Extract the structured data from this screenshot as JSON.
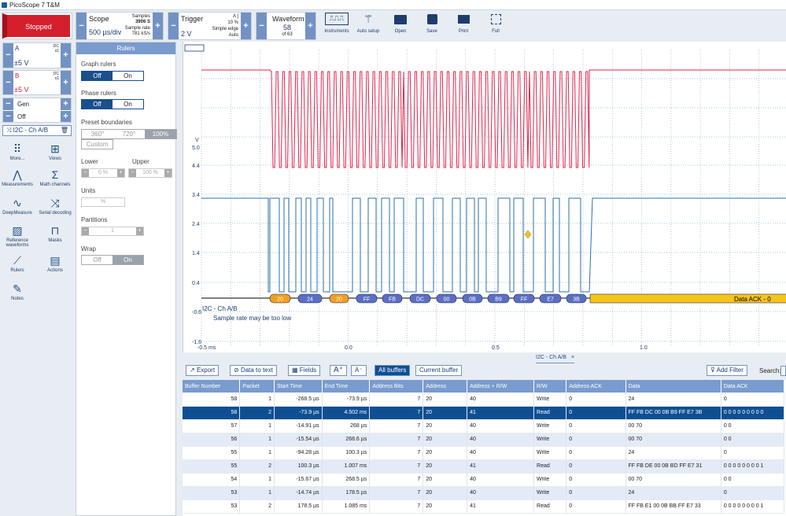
{
  "app": {
    "title": "PicoScope 7 T&M",
    "status": "Stopped"
  },
  "scope": {
    "label": "Scope",
    "timebase": "500 µs/div",
    "samples_label": "Samples",
    "samples": "3906 S",
    "rate_label": "Sample rate",
    "rate": "781 kS/s"
  },
  "trigger": {
    "label": "Trigger",
    "level": "2 V",
    "channel": "A",
    "percent": "10 %",
    "type": "Simple edge",
    "mode": "Auto"
  },
  "waveform": {
    "label": "Waveform",
    "current": "58",
    "of": "of 63"
  },
  "toolbar": {
    "instruments": "Instruments",
    "auto_setup": "Auto setup",
    "open": "Open",
    "save": "Save",
    "print": "Print",
    "full": "Full"
  },
  "channels": {
    "a": {
      "name": "A",
      "coupling": "DC",
      "probe": "x1",
      "range": "±5 V"
    },
    "b": {
      "name": "B",
      "coupling": "DC",
      "probe": "x1",
      "range": "±5 V"
    },
    "gen": {
      "name": "Gen",
      "state": "Off"
    }
  },
  "decoder": {
    "label": "I2C - Ch A/B"
  },
  "sidebar": {
    "more": "More...",
    "views": "Views",
    "measurements": "Measurements",
    "math": "Math channels",
    "deepmeasure": "DeepMeasure",
    "serial": "Serial decoding",
    "reference": "Reference waveforms",
    "masks": "Masks",
    "rulers": "Rulers",
    "actions": "Actions",
    "notes": "Notes"
  },
  "rulers": {
    "title": "Rulers",
    "graph": "Graph rulers",
    "phase": "Phase rulers",
    "off": "Off",
    "on": "On",
    "preset": "Preset boundaries",
    "p360": "360°",
    "p720": "720°",
    "p100": "100%",
    "custom": "Custom",
    "lower": "Lower",
    "upper": "Upper",
    "lower_val": "0 %",
    "upper_val": "100 %",
    "units": "Units",
    "units_val": "%",
    "partitions": "Partitions",
    "partitions_val": "1",
    "wrap": "Wrap"
  },
  "plot": {
    "v_unit": "V",
    "yticks": [
      "5.0",
      "4.4",
      "3.4",
      "2.4",
      "1.4",
      "0.4",
      "-0.6",
      "-1.6"
    ],
    "xticks": [
      "-0.5 ms",
      "0.0",
      "0.5",
      "1.0"
    ],
    "warn_ch": "I2C - Ch A/B",
    "warn": "Sample rate may be too low",
    "ack": "Data ACK - 0",
    "packets": [
      "20",
      "24",
      "20",
      "FF",
      "FB",
      "DC",
      "00",
      "0B",
      "B9",
      "FF",
      "E7",
      "3B"
    ]
  },
  "bottom": {
    "tab": "I2C - Ch A/B",
    "export": "Export",
    "data_to_text": "Data to text",
    "fields": "Fields",
    "all_buffers": "All buffers",
    "current_buffer": "Current buffer",
    "add_filter": "Add Filter",
    "search": "Search:"
  },
  "table": {
    "headers": [
      "Buffer Number",
      "Packet",
      "Start Time",
      "End Time",
      "Address Bits",
      "Address",
      "Address + R/W",
      "R/W",
      "Address ACK",
      "Data",
      "Data ACK"
    ],
    "rows": [
      [
        "58",
        "1",
        "-268.5 µs",
        "-73.9 µs",
        "7",
        "20",
        "40",
        "Write",
        "0",
        "24",
        "0"
      ],
      [
        "58",
        "2",
        "-73.9 µs",
        "4.502 ms",
        "7",
        "20",
        "41",
        "Read",
        "0",
        "FF FB DC 00 0B B9 FF E7 3B",
        "0 0 0 0 0 0 0 0 0"
      ],
      [
        "57",
        "1",
        "-14.91 µs",
        "268 µs",
        "7",
        "20",
        "40",
        "Write",
        "0",
        "00 70",
        "0 0"
      ],
      [
        "56",
        "1",
        "-15.54 µs",
        "268.6 µs",
        "7",
        "20",
        "40",
        "Write",
        "0",
        "00 70",
        "0 0"
      ],
      [
        "55",
        "1",
        "-94.28 µs",
        "100.3 µs",
        "7",
        "20",
        "40",
        "Write",
        "0",
        "24",
        "0"
      ],
      [
        "55",
        "2",
        "100.3 µs",
        "1.007 ms",
        "7",
        "20",
        "41",
        "Read",
        "0",
        "FF FB DE 00 0B BD FF E7 31",
        "0 0 0 0 0 0 0 0 1"
      ],
      [
        "54",
        "1",
        "-15.67 µs",
        "268.5 µs",
        "7",
        "20",
        "40",
        "Write",
        "0",
        "00 70",
        "0 0"
      ],
      [
        "53",
        "1",
        "-14.74 µs",
        "178.5 µs",
        "7",
        "20",
        "40",
        "Write",
        "0",
        "24",
        "0"
      ],
      [
        "53",
        "2",
        "178.5 µs",
        "1.085 ms",
        "7",
        "20",
        "41",
        "Read",
        "0",
        "FF FB E1 00 0B BB FF E7 33",
        "0 0 0 0 0 0 0 0 1"
      ]
    ]
  }
}
